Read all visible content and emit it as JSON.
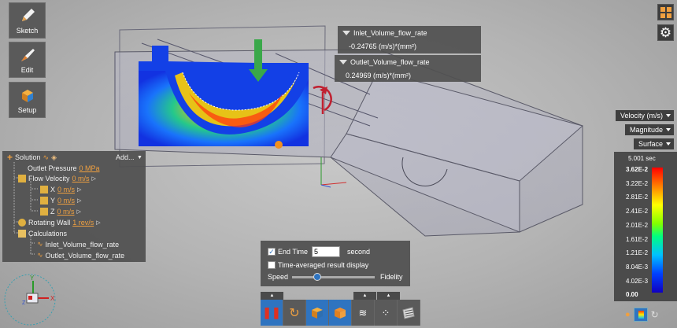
{
  "toolbar": {
    "sketch_label": "Sketch",
    "edit_label": "Edit",
    "setup_label": "Setup"
  },
  "tooltips": {
    "inlet": {
      "name": "Inlet_Volume_flow_rate",
      "value": "-0.24765 (m/s)*(mm²)"
    },
    "outlet": {
      "name": "Outlet_Volume_flow_rate",
      "value": "0.24969 (m/s)*(mm²)"
    }
  },
  "tree": {
    "title": "Solution",
    "add_label": "Add...",
    "outlet_pressure": {
      "label": "Outlet Pressure",
      "value": "0 MPa"
    },
    "flow_velocity": {
      "label": "Flow Velocity",
      "value": "0 m/s"
    },
    "x": {
      "label": "X",
      "value": "0 m/s"
    },
    "y": {
      "label": "Y",
      "value": "0 m/s"
    },
    "z": {
      "label": "Z",
      "value": "0 m/s"
    },
    "rotating_wall": {
      "label": "Rotating Wall",
      "value": "1 rev/s"
    },
    "calculations": "Calculations",
    "calc1": "Inlet_Volume_flow_rate",
    "calc2": "Outlet_Volume_flow_rate"
  },
  "legend": {
    "variable": "Velocity (m/s)",
    "component": "Magnitude",
    "display": "Surface",
    "time": "5.001 sec",
    "ticks": [
      "3.62E-2",
      "3.22E-2",
      "2.81E-2",
      "2.41E-2",
      "2.01E-2",
      "1.61E-2",
      "1.21E-2",
      "8.04E-3",
      "4.02E-3",
      "0.00"
    ]
  },
  "controls": {
    "end_time_label": "End Time",
    "end_time_value": "5",
    "end_time_unit": "second",
    "end_time_checked": true,
    "time_avg_label": "Time-averaged result display",
    "time_avg_checked": false,
    "speed_label": "Speed",
    "fidelity_label": "Fidelity",
    "slider_value": 0.3
  },
  "triad": {
    "x": "X",
    "y": "Y",
    "z": "Z"
  },
  "colors": {
    "accent": "#2f74c0",
    "orange": "#f0a040"
  }
}
